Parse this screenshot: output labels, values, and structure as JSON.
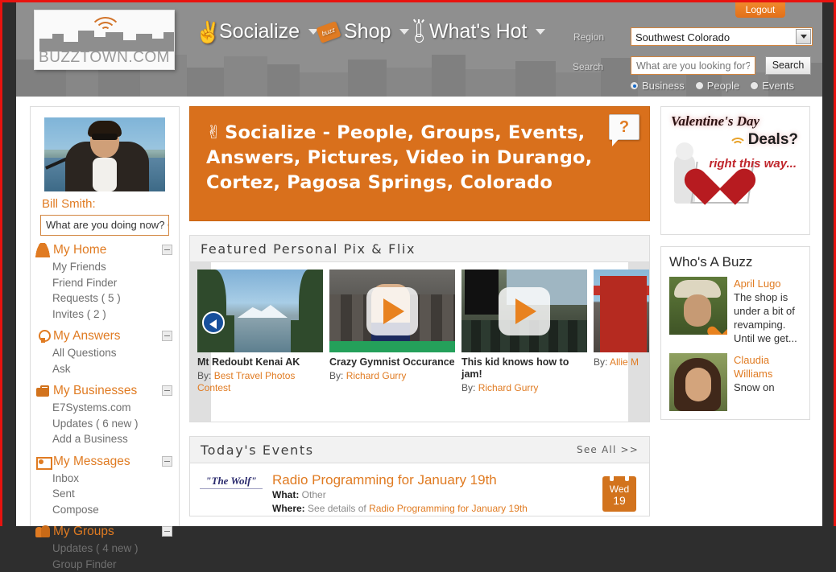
{
  "header": {
    "logo_text": "BUZZTOWN.COM",
    "logout_label": "Logout",
    "nav": [
      {
        "label": "Socialize",
        "icon": "peace-sign-icon"
      },
      {
        "label": "Shop",
        "icon": "buzz-tag-icon"
      },
      {
        "label": "What's Hot",
        "icon": "thermometer-icon"
      }
    ],
    "region_label": "Region",
    "region_value": "Southwest Colorado",
    "search_label": "Search",
    "search_placeholder": "What are you looking for?",
    "search_button": "Search",
    "radios": [
      {
        "label": "Business",
        "selected": true
      },
      {
        "label": "People",
        "selected": false
      },
      {
        "label": "Events",
        "selected": false
      }
    ]
  },
  "sidebar": {
    "user_name": "Bill Smith:",
    "status_placeholder": "What are you doing now? C",
    "groups": [
      {
        "title": "My Home",
        "icon": "person-icon",
        "items": [
          "My Friends",
          "Friend Finder",
          "Requests ( 5 )",
          "Invites ( 2 )"
        ]
      },
      {
        "title": "My Answers",
        "icon": "lightbulb-icon",
        "items": [
          "All Questions",
          "Ask"
        ]
      },
      {
        "title": "My Businesses",
        "icon": "briefcase-icon",
        "items": [
          "E7Systems.com",
          "Updates ( 6 new )",
          "Add a Business"
        ]
      },
      {
        "title": "My Messages",
        "icon": "envelope-icon",
        "items": [
          "Inbox",
          "Sent",
          "Compose"
        ]
      },
      {
        "title": "My Groups",
        "icon": "people-icon",
        "items": [
          "Updates ( 4 new )",
          "Group Finder"
        ]
      }
    ]
  },
  "banner": {
    "title": "Socialize - People, Groups, Events, Answers, Pictures, Video in Durango, Cortez, Pagosa Springs, Colorado",
    "help_glyph": "?",
    "bg_color": "#d9701c"
  },
  "featured": {
    "title": "Featured Personal Pix & Flix",
    "by_prefix": "By:",
    "cards": [
      {
        "title": "Mt Redoubt Kenai AK",
        "author": "Best Travel Photos Contest",
        "media": "photo",
        "art": "ph-mt"
      },
      {
        "title": "Crazy Gymnist Occurance",
        "author": "Richard Gurry",
        "media": "video",
        "art": "ph-gym"
      },
      {
        "title": "This kid knows how to jam!",
        "author": "Richard Gurry",
        "media": "video",
        "art": "ph-jam"
      },
      {
        "title": "",
        "author": "Allie M",
        "media": "photo",
        "art": "ph-red"
      }
    ]
  },
  "events": {
    "title": "Today's Events",
    "see_all": "See All >>",
    "item": {
      "logo_text": "\"The Wolf\"",
      "title": "Radio Programming for January 19th",
      "what_label": "What:",
      "what_value": "Other",
      "where_label": "Where:",
      "where_prefix": "See details of",
      "where_link": "Radio Programming for January 19th",
      "cal_day": "Wed",
      "cal_num": "19"
    }
  },
  "ad": {
    "line1": "Valentine's Day",
    "line2": "Deals?",
    "line3": "right this way..."
  },
  "buzz": {
    "title": "Who's A Buzz",
    "items": [
      {
        "name": "April Lugo",
        "text": "The shop is under a bit of revamping. Until we get...",
        "pic": "bp1"
      },
      {
        "name": "Claudia Williams",
        "text": "Snow on",
        "pic": "bp2"
      }
    ]
  }
}
